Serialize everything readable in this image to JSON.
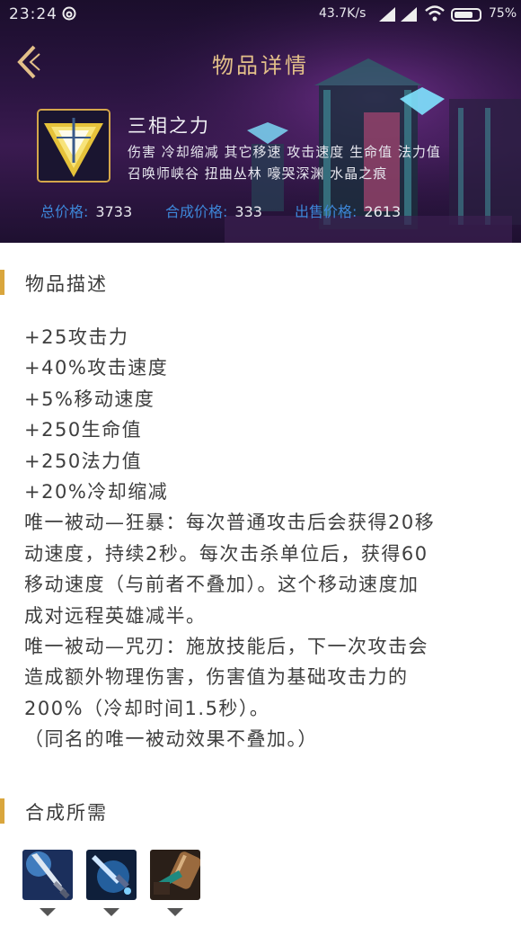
{
  "status": {
    "time": "23:24",
    "speed": "43.7K/s",
    "battery": "75%",
    "battery_level": 0.75
  },
  "header": {
    "title": "物品详情"
  },
  "item": {
    "name": "三相之力",
    "tags_line1": "伤害 冷却缩减 其它移速 攻击速度 生命值 法力值",
    "tags_line2": "召唤师峡谷 扭曲丛林 嚎哭深渊 水晶之痕",
    "prices": [
      {
        "label": "总价格:",
        "value": "3733"
      },
      {
        "label": "合成价格:",
        "value": "333"
      },
      {
        "label": "出售价格:",
        "value": "2613"
      }
    ]
  },
  "description": {
    "title": "物品描述",
    "lines": [
      "+25攻击力",
      "+40%攻击速度",
      "+5%移动速度",
      "+250生命值",
      "+250法力值",
      "+20%冷却缩减",
      "唯一被动—狂暴：每次普通攻击后会获得20移",
      "动速度，持续2秒。每次击杀单位后，获得60",
      "移动速度（与前者不叠加）。这个移动速度加",
      "成对远程英雄减半。",
      "唯一被动—咒刃：施放技能后，下一次攻击会",
      "造成额外物理伤害，伤害值为基础攻击力的",
      "200%（冷却时间1.5秒）。",
      "（同名的唯一被动效果不叠加。）"
    ]
  },
  "components": {
    "title": "合成所需",
    "items": [
      {
        "icon": "sword-icon"
      },
      {
        "icon": "dagger-icon"
      },
      {
        "icon": "hammer-icon"
      }
    ]
  },
  "colors": {
    "accent_gold": "#d9a63d",
    "price_blue": "#3d86d8",
    "title_gold": "#e3c089"
  }
}
